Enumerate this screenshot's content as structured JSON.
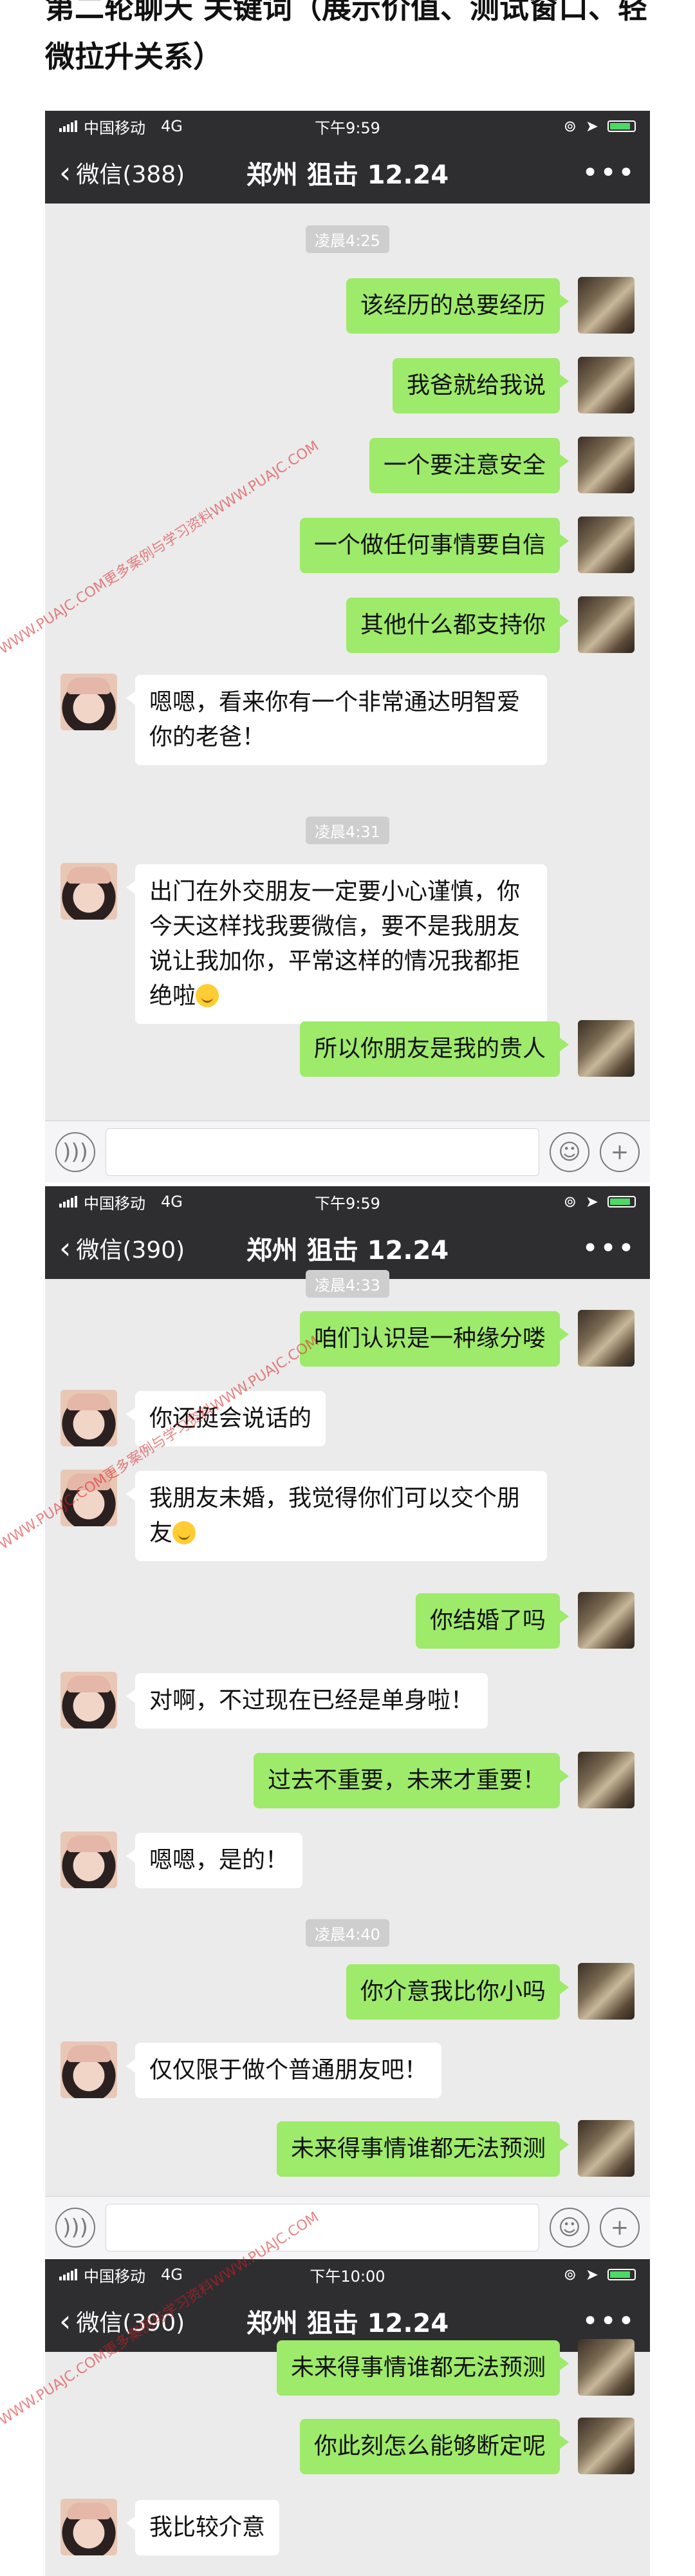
{
  "heading": "第二轮聊天 关键词（展示价值、测试窗口、轻微拉升关系）",
  "watermark": "WWW.PUAJC.COM更多案例与学习资料WWW.PUAJC.COM",
  "screens": [
    {
      "status": {
        "carrier": "中国移动",
        "network": "4G",
        "time": "下午9:59"
      },
      "nav": {
        "back_label": "微信(388)",
        "title": "郑州 狙击 12.24"
      },
      "items": [
        {
          "kind": "ts",
          "text": "凌晨4:25"
        },
        {
          "kind": "me",
          "text": "该经历的总要经历"
        },
        {
          "kind": "me",
          "text": "我爸就给我说"
        },
        {
          "kind": "me",
          "text": "一个要注意安全"
        },
        {
          "kind": "me",
          "text": "一个做任何事情要自信"
        },
        {
          "kind": "me",
          "text": "其他什么都支持你"
        },
        {
          "kind": "her",
          "text": "嗯嗯，看来你有一个非常通达明智爱你的老爸！"
        },
        {
          "kind": "ts",
          "text": "凌晨4:31"
        },
        {
          "kind": "her",
          "text": "出门在外交朋友一定要小心谨慎，你今天这样找我要微信，要不是我朋友说让我加你，平常这样的情况我都拒绝啦"
        },
        {
          "kind": "me",
          "text": "所以你朋友是我的贵人"
        }
      ]
    },
    {
      "status": {
        "carrier": "中国移动",
        "network": "4G",
        "time": "下午9:59"
      },
      "nav": {
        "back_label": "微信(390)",
        "title": "郑州 狙击 12.24"
      },
      "items": [
        {
          "kind": "ts",
          "text": "凌晨4:33"
        },
        {
          "kind": "me",
          "text": "咱们认识是一种缘分喽"
        },
        {
          "kind": "her",
          "text": "你还挺会说话的"
        },
        {
          "kind": "her",
          "text": "我朋友未婚，我觉得你们可以交个朋友"
        },
        {
          "kind": "me",
          "text": "你结婚了吗"
        },
        {
          "kind": "her",
          "text": "对啊，不过现在已经是单身啦！"
        },
        {
          "kind": "me",
          "text": "过去不重要，未来才重要！"
        },
        {
          "kind": "her",
          "text": "嗯嗯，是的！"
        },
        {
          "kind": "ts",
          "text": "凌晨4:40"
        },
        {
          "kind": "me",
          "text": "你介意我比你小吗"
        },
        {
          "kind": "her",
          "text": "仅仅限于做个普通朋友吧！"
        },
        {
          "kind": "me",
          "text": "未来得事情谁都无法预测"
        }
      ]
    },
    {
      "status": {
        "carrier": "中国移动",
        "network": "4G",
        "time": "下午10:00"
      },
      "nav": {
        "back_label": "微信(390)",
        "title": "郑州 狙击 12.24"
      },
      "items": [
        {
          "kind": "me",
          "text": "未来得事情谁都无法预测"
        },
        {
          "kind": "me",
          "text": "你此刻怎么能够断定呢"
        },
        {
          "kind": "her",
          "text": "我比较介意"
        }
      ]
    }
  ]
}
